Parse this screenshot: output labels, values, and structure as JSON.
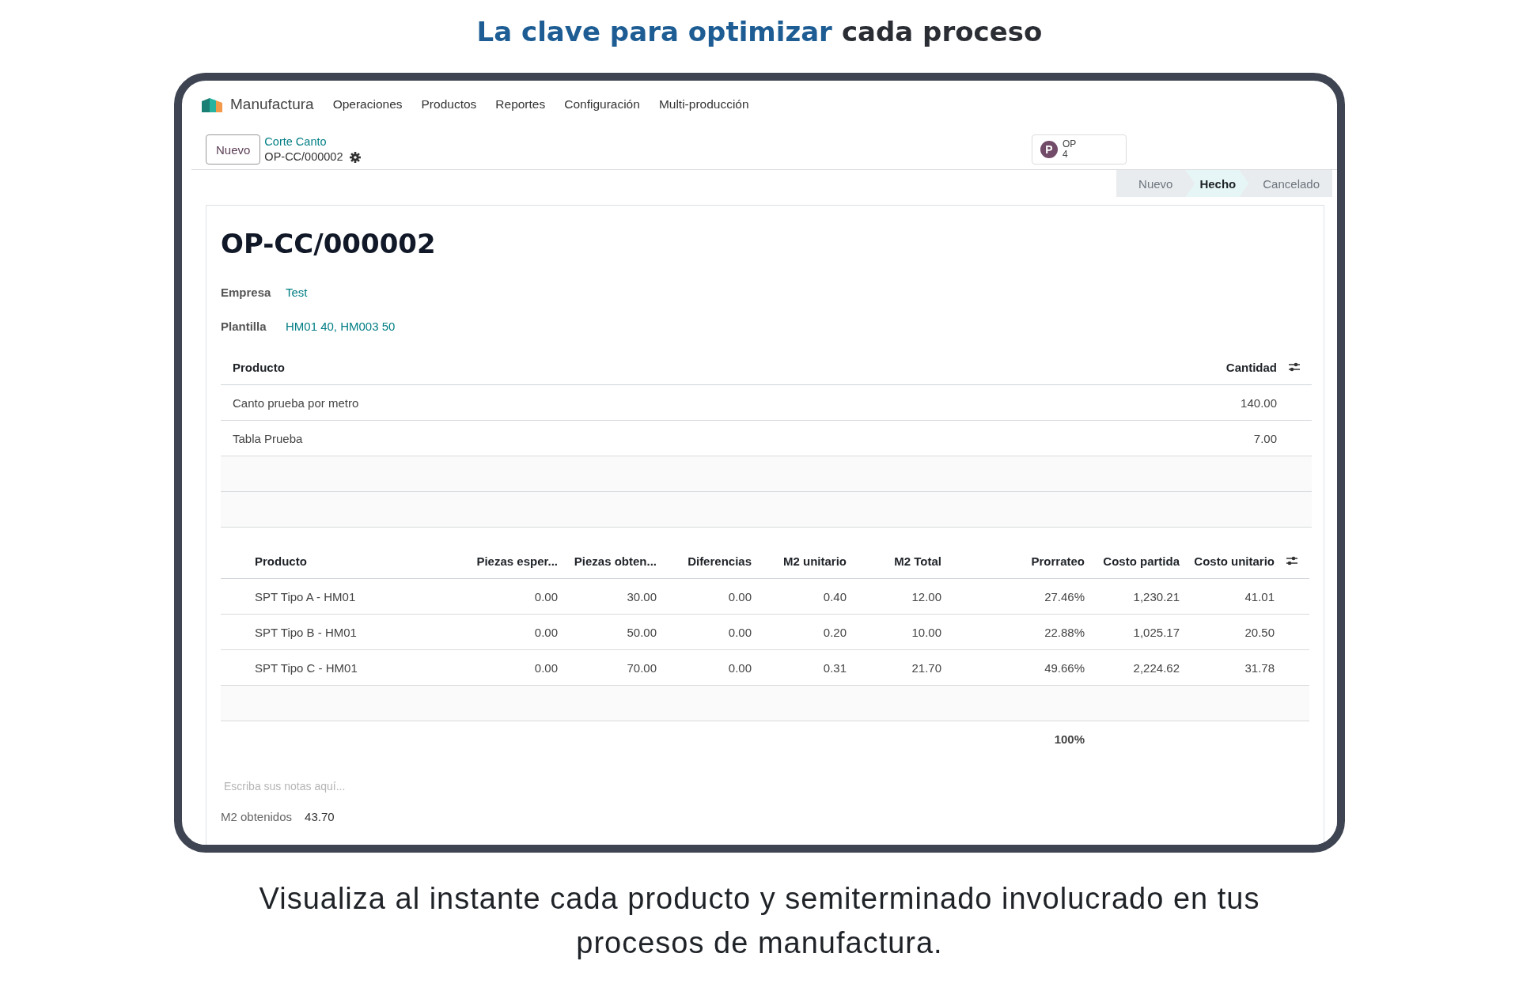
{
  "headline": [
    {
      "text": "La clave para optimizar",
      "accent": true
    },
    {
      "text": "cada proceso",
      "accent": false
    }
  ],
  "app": {
    "name": "Manufactura",
    "menu": [
      "Operaciones",
      "Productos",
      "Reportes",
      "Configuración",
      "Multi-producción"
    ]
  },
  "breadcrumb": {
    "new_button": "Nuevo",
    "parent": "Corte Canto",
    "current": "OP-CC/000002"
  },
  "badge": {
    "initial": "P",
    "label": "OP",
    "count": "4"
  },
  "stages": [
    {
      "label": "Nuevo",
      "selected": false
    },
    {
      "label": "Hecho",
      "selected": true
    },
    {
      "label": "Cancelado",
      "selected": false
    }
  ],
  "record": {
    "title": "OP-CC/000002",
    "fields": [
      {
        "label": "Empresa",
        "value": "Test"
      },
      {
        "label": "Plantilla",
        "value": "HM01 40, HM003 50"
      }
    ]
  },
  "products_table": {
    "columns": [
      "Producto",
      "Cantidad"
    ],
    "rows": [
      [
        "Canto prueba por metro",
        "140.00"
      ],
      [
        "Tabla Prueba",
        "7.00"
      ]
    ]
  },
  "results_table": {
    "columns": [
      "Producto",
      "Piezas esper...",
      "Piezas obten...",
      "Diferencias",
      "M2 unitario",
      "M2 Total",
      "Prorrateo",
      "Costo partida",
      "Costo unitario"
    ],
    "rows": [
      [
        "SPT Tipo A - HM01",
        "0.00",
        "30.00",
        "0.00",
        "0.40",
        "12.00",
        "27.46%",
        "1,230.21",
        "41.01"
      ],
      [
        "SPT Tipo B - HM01",
        "0.00",
        "50.00",
        "0.00",
        "0.20",
        "10.00",
        "22.88%",
        "1,025.17",
        "20.50"
      ],
      [
        "SPT Tipo C - HM01",
        "0.00",
        "70.00",
        "0.00",
        "0.31",
        "21.70",
        "49.66%",
        "2,224.62",
        "31.78"
      ]
    ],
    "total": "100%"
  },
  "notes": {
    "placeholder": "Escriba sus notas aquí..."
  },
  "summary": {
    "label": "M2 obtenidos",
    "value": "43.70"
  },
  "caption": "Visualiza al instante cada producto y semiterminado involucrado en tus procesos de manufactura."
}
